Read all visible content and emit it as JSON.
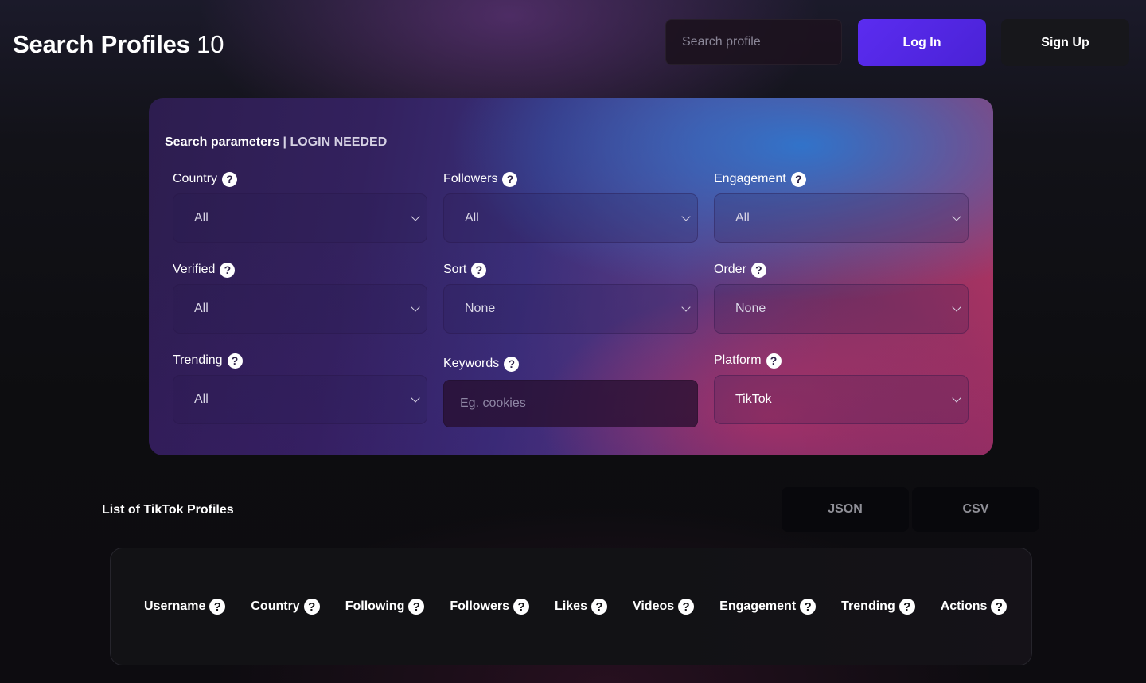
{
  "header": {
    "title": "Search Profiles",
    "count": "10",
    "search_placeholder": "Search profile",
    "login_label": "Log In",
    "signup_label": "Sign Up"
  },
  "params": {
    "heading": "Search parameters",
    "separator": " | ",
    "login_note": "LOGIN NEEDED",
    "help_glyph": "?",
    "fields": [
      {
        "label": "Country",
        "type": "select",
        "value": "All"
      },
      {
        "label": "Followers",
        "type": "select",
        "value": "All"
      },
      {
        "label": "Engagement",
        "type": "select",
        "value": "All"
      },
      {
        "label": "Verified",
        "type": "select",
        "value": "All"
      },
      {
        "label": "Sort",
        "type": "select",
        "value": "None"
      },
      {
        "label": "Order",
        "type": "select",
        "value": "None"
      },
      {
        "label": "Trending",
        "type": "select",
        "value": "All"
      },
      {
        "label": "Keywords",
        "type": "text",
        "value": "",
        "placeholder": "Eg. cookies"
      },
      {
        "label": "Platform",
        "type": "select",
        "value": "TikTok"
      }
    ]
  },
  "list": {
    "title": "List of TikTok Profiles",
    "export_json": "JSON",
    "export_csv": "CSV",
    "columns": [
      "Username",
      "Country",
      "Following",
      "Followers",
      "Likes",
      "Videos",
      "Engagement",
      "Trending",
      "Actions"
    ]
  },
  "colors": {
    "primary": "#5b2cf0",
    "card_blue": "#2e76ce",
    "card_pink": "#c8376a",
    "card_purple": "#33215e"
  }
}
